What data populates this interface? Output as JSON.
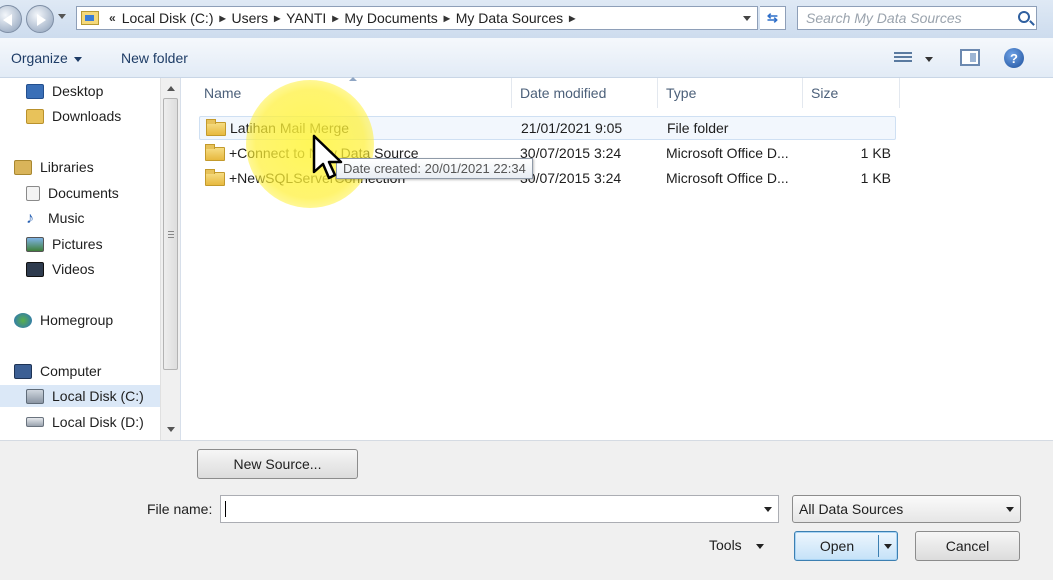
{
  "address": {
    "chevron_prefix": "«",
    "crumbs": [
      "Local Disk (C:)",
      "Users",
      "YANTI",
      "My Documents",
      "My Data Sources"
    ],
    "search_placeholder": "Search My Data Sources"
  },
  "toolbar": {
    "organize_label": "Organize",
    "new_folder_label": "New folder"
  },
  "nav": {
    "items": [
      {
        "label": "Desktop",
        "icon": "desktop-icon"
      },
      {
        "label": "Downloads",
        "icon": "downloads-icon"
      },
      {
        "label": "Libraries",
        "icon": "libraries-icon"
      },
      {
        "label": "Documents",
        "icon": "documents-icon"
      },
      {
        "label": "Music",
        "icon": "music-icon"
      },
      {
        "label": "Pictures",
        "icon": "pictures-icon"
      },
      {
        "label": "Videos",
        "icon": "videos-icon"
      },
      {
        "label": "Homegroup",
        "icon": "homegroup-icon"
      },
      {
        "label": "Computer",
        "icon": "computer-icon"
      },
      {
        "label": "Local Disk (C:)",
        "icon": "drive-icon"
      },
      {
        "label": "Local Disk (D:)",
        "icon": "drive-icon"
      }
    ]
  },
  "columns": {
    "name": "Name",
    "date": "Date modified",
    "type": "Type",
    "size": "Size"
  },
  "files": [
    {
      "name": "Latihan Mail Merge",
      "date": "21/01/2021 9:05",
      "type": "File folder",
      "size": ""
    },
    {
      "name": "+Connect to New Data Source",
      "date": "30/07/2015 3:24",
      "type": "Microsoft Office D...",
      "size": "1 KB"
    },
    {
      "name": "+NewSQLServerConnection",
      "date": "30/07/2015 3:24",
      "type": "Microsoft Office D...",
      "size": "1 KB"
    }
  ],
  "tooltip": "Date created: 20/01/2021 22:34",
  "bottom": {
    "new_source_label": "New Source...",
    "file_name_label": "File name:",
    "file_name_value": "",
    "filter_value": "All Data Sources",
    "tools_label": "Tools",
    "open_label": "Open",
    "cancel_label": "Cancel"
  },
  "colors": {
    "accent": "#3c7fb1",
    "highlight": "#fff53c"
  }
}
